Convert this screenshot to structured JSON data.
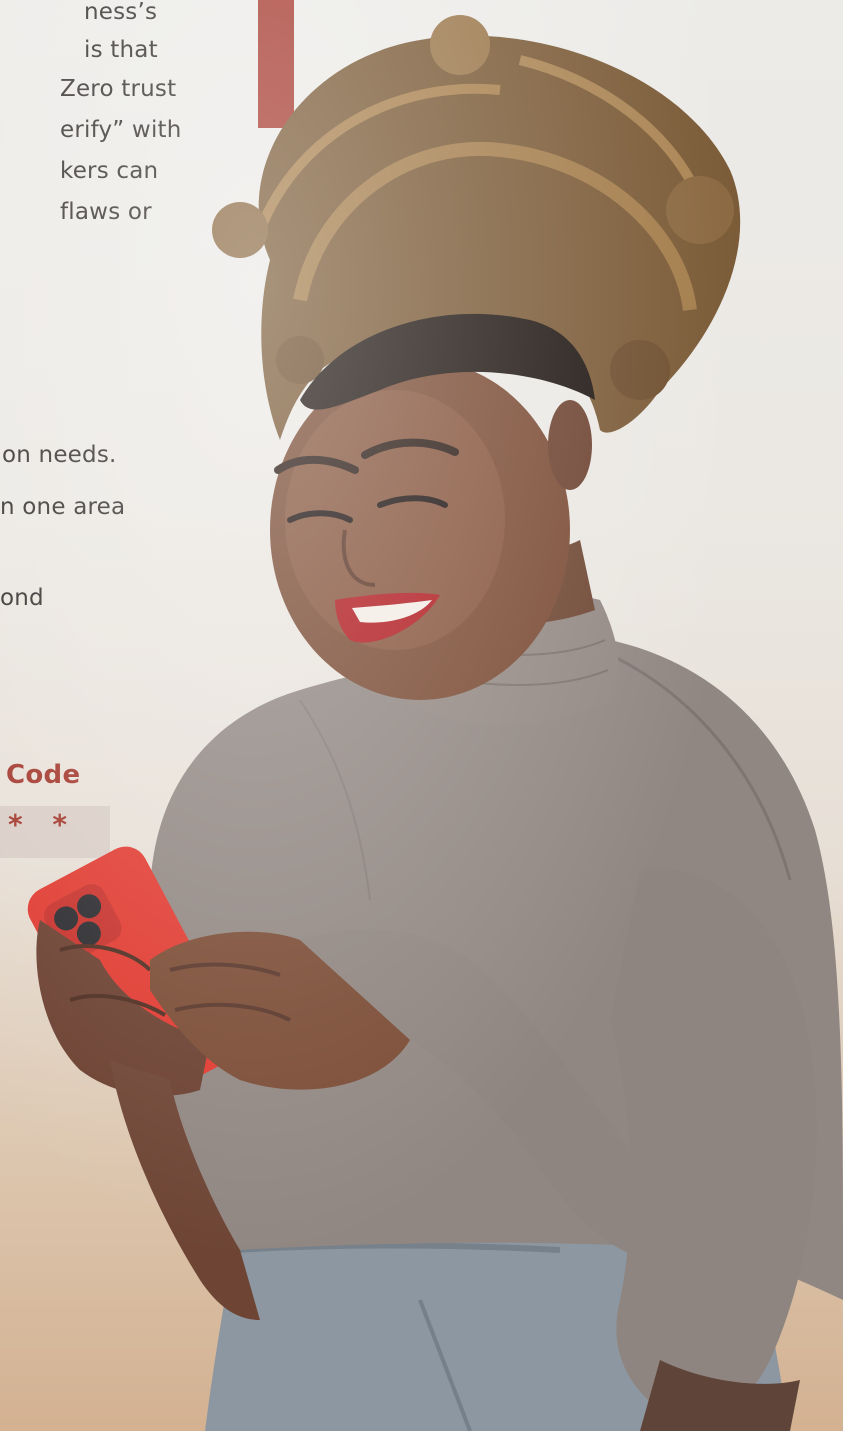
{
  "article": {
    "lines": [
      "ness’s",
      "is that",
      "Zero trust",
      "erify” with",
      "kers can",
      "flaws or",
      "on needs.",
      "n one area",
      "ond"
    ]
  },
  "code_form": {
    "label": "Code",
    "masked_value": "* *"
  },
  "photo": {
    "description_icon": "woman-with-phone"
  },
  "colors": {
    "accent": "#a63a2f",
    "label_red": "#a2362b",
    "text": "#2e2a28",
    "phone_red": "#e0392f",
    "sweater": "#918782",
    "trousers": "#8c97a1"
  }
}
